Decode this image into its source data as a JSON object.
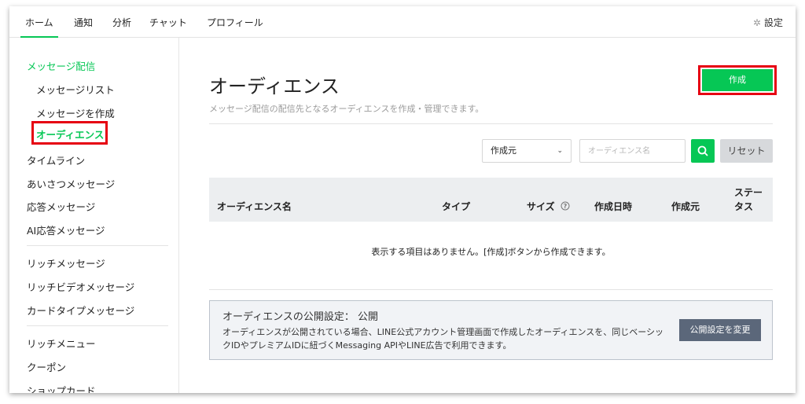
{
  "topnav": {
    "tabs": [
      {
        "label": "ホーム"
      },
      {
        "label": "通知"
      },
      {
        "label": "分析"
      },
      {
        "label": "チャット"
      },
      {
        "label": "プロフィール"
      }
    ],
    "settings_label": "設定"
  },
  "sidebar": {
    "items": [
      {
        "label": "メッセージ配信"
      },
      {
        "label": "メッセージリスト"
      },
      {
        "label": "メッセージを作成"
      },
      {
        "label": "オーディエンス"
      },
      {
        "label": "タイムライン"
      },
      {
        "label": "あいさつメッセージ"
      },
      {
        "label": "応答メッセージ"
      },
      {
        "label": "AI応答メッセージ"
      },
      {
        "label": "リッチメッセージ"
      },
      {
        "label": "リッチビデオメッセージ"
      },
      {
        "label": "カードタイプメッセージ"
      },
      {
        "label": "リッチメニュー"
      },
      {
        "label": "クーポン"
      },
      {
        "label": "ショップカード"
      }
    ]
  },
  "main": {
    "title": "オーディエンス",
    "description": "メッセージ配信の配信先となるオーディエンスを作成・管理できます。",
    "create_label": "作成",
    "filter": {
      "select_value": "作成元",
      "search_placeholder": "オーディエンス名",
      "reset_label": "リセット"
    },
    "table": {
      "columns": {
        "name": "オーディエンス名",
        "type": "タイプ",
        "size": "サイズ",
        "created": "作成日時",
        "source": "作成元",
        "status_line1": "ステー",
        "status_line2": "タス"
      },
      "empty_message": "表示する項目はありません。[作成]ボタンから作成できます。"
    },
    "publish_panel": {
      "title": "オーディエンスの公開設定： 公開",
      "text": "オーディエンスが公開されている場合、LINE公式アカウント管理画面で作成したオーディエンスを、同じベーシックIDやプレミアムIDに紐づくMessaging APIやLINE広告で利用できます。",
      "button_label": "公開設定を変更"
    }
  },
  "colors": {
    "accent_green": "#06c755",
    "highlight_red": "#e60012",
    "panel_button": "#5b677a"
  },
  "icons": {
    "settings": "gear-icon",
    "search": "search-icon",
    "select": "chevron-down-icon",
    "help": "question-circle-icon"
  }
}
